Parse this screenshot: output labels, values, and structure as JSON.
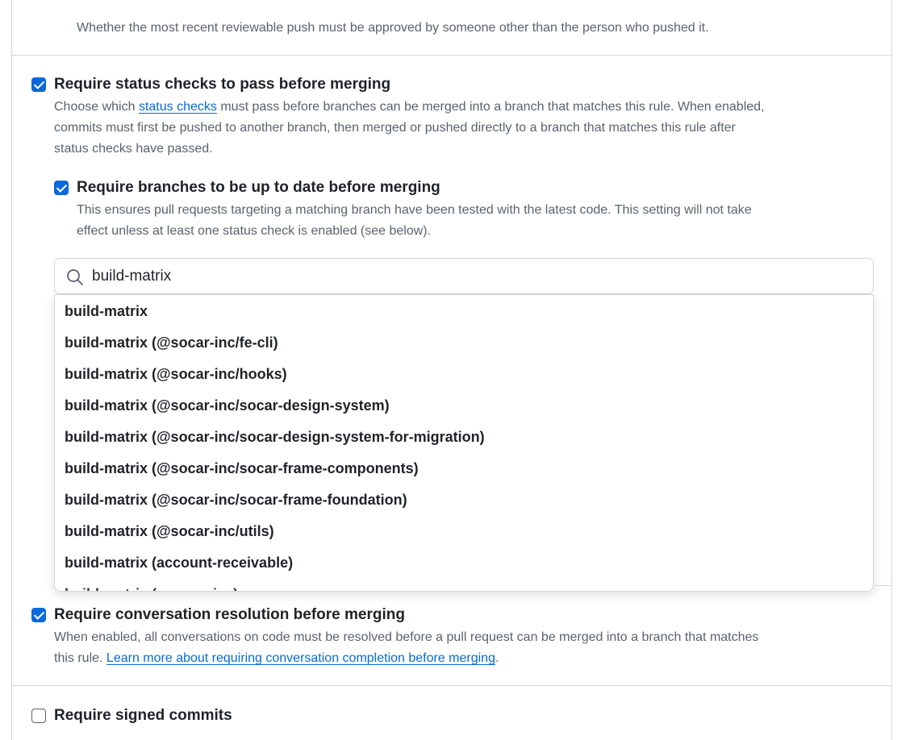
{
  "approval": {
    "description": "Whether the most recent reviewable push must be approved by someone other than the person who pushed it."
  },
  "status_checks": {
    "checked": true,
    "title": "Require status checks to pass before merging",
    "desc_prefix": "Choose which ",
    "desc_link": "status checks",
    "desc_line1_rest": " must pass before branches can be merged into a branch that matches this rule. When enabled,",
    "desc_line2": "commits must first be pushed to another branch, then merged or pushed directly to a branch that matches this rule after",
    "desc_line3": "status checks have passed."
  },
  "up_to_date": {
    "checked": true,
    "title": "Require branches to be up to date before merging",
    "desc_line1": "This ensures pull requests targeting a matching branch have been tested with the latest code. This setting will not take",
    "desc_line2": "effect unless at least one status check is enabled (see below)."
  },
  "search": {
    "icon": "search-icon",
    "value": "build-matrix"
  },
  "dropdown": {
    "items": [
      "build-matrix",
      "build-matrix (@socar-inc/fe-cli)",
      "build-matrix (@socar-inc/hooks)",
      "build-matrix (@socar-inc/socar-design-system)",
      "build-matrix (@socar-inc/socar-design-system-for-migration)",
      "build-matrix (@socar-inc/socar-frame-components)",
      "build-matrix (@socar-inc/socar-frame-foundation)",
      "build-matrix (@socar-inc/utils)",
      "build-matrix (account-receivable)",
      "build-matrix (car-service)"
    ]
  },
  "conversation": {
    "checked": true,
    "title": "Require conversation resolution before merging",
    "desc_line1": "When enabled, all conversations on code must be resolved before a pull request can be merged into a branch that matches",
    "desc_line2_prefix": "this rule. ",
    "desc_link": "Learn more about requiring conversation completion before merging",
    "desc_suffix": "."
  },
  "signed_commits": {
    "checked": false,
    "title": "Require signed commits"
  },
  "colors": {
    "accent": "#0969da",
    "text": "#1f2328",
    "muted": "#59636e",
    "border": "#d0d7de"
  }
}
